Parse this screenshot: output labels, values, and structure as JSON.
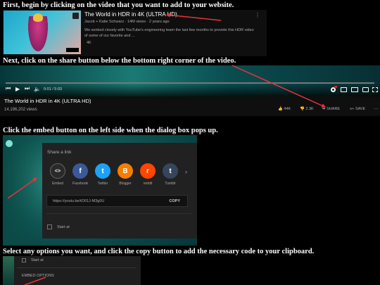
{
  "steps": {
    "s1": "First, begin by clicking on the video that you want to add to your website.",
    "s2": "Next, click on the share button below the bottom right corner of the video.",
    "s3": "Click the embed button on the left side when the dialog box pops up.",
    "s4": "Select any options you want, and click the copy button to add the necessary code to your clipboard."
  },
  "search_result": {
    "title": "The World in HDR in 4K (ULTRA HD)",
    "meta": "Jacob + Katie Schwarz · 14M views · 2 years ago",
    "desc": "We worked closely with YouTube's engineering team the last few months to provide this HDR video of some of our favorite and ...",
    "badge": "4K"
  },
  "player": {
    "time": "0:01 / 5:03",
    "title": "The World in HDR in 4K (ULTRA HD)",
    "views": "14,196,202 views",
    "likes": "44K",
    "dislikes": "2.3K",
    "share": "SHARE",
    "save": "SAVE"
  },
  "share_dialog": {
    "heading": "Share a link",
    "targets": [
      {
        "label": "Embed",
        "glyph": "<>",
        "color": "#2a2a2a"
      },
      {
        "label": "Facebook",
        "glyph": "f",
        "color": "#3b5998"
      },
      {
        "label": "Twitter",
        "glyph": "t",
        "color": "#1da1f2"
      },
      {
        "label": "Blogger",
        "glyph": "B",
        "color": "#f57d00"
      },
      {
        "label": "reddit",
        "glyph": "r",
        "color": "#ff4500"
      },
      {
        "label": "Tumblr",
        "glyph": "t",
        "color": "#35465c"
      }
    ],
    "url": "https://youtu.be/tO01J-M3g0U",
    "copy": "COPY",
    "start_at": "Start at"
  },
  "embed_options": {
    "start_at": "Start at",
    "heading": "EMBED OPTIONS"
  },
  "colors": {
    "arrow": "#e8333a",
    "ocean": "#0f6d6a",
    "dialog": "#212121"
  }
}
